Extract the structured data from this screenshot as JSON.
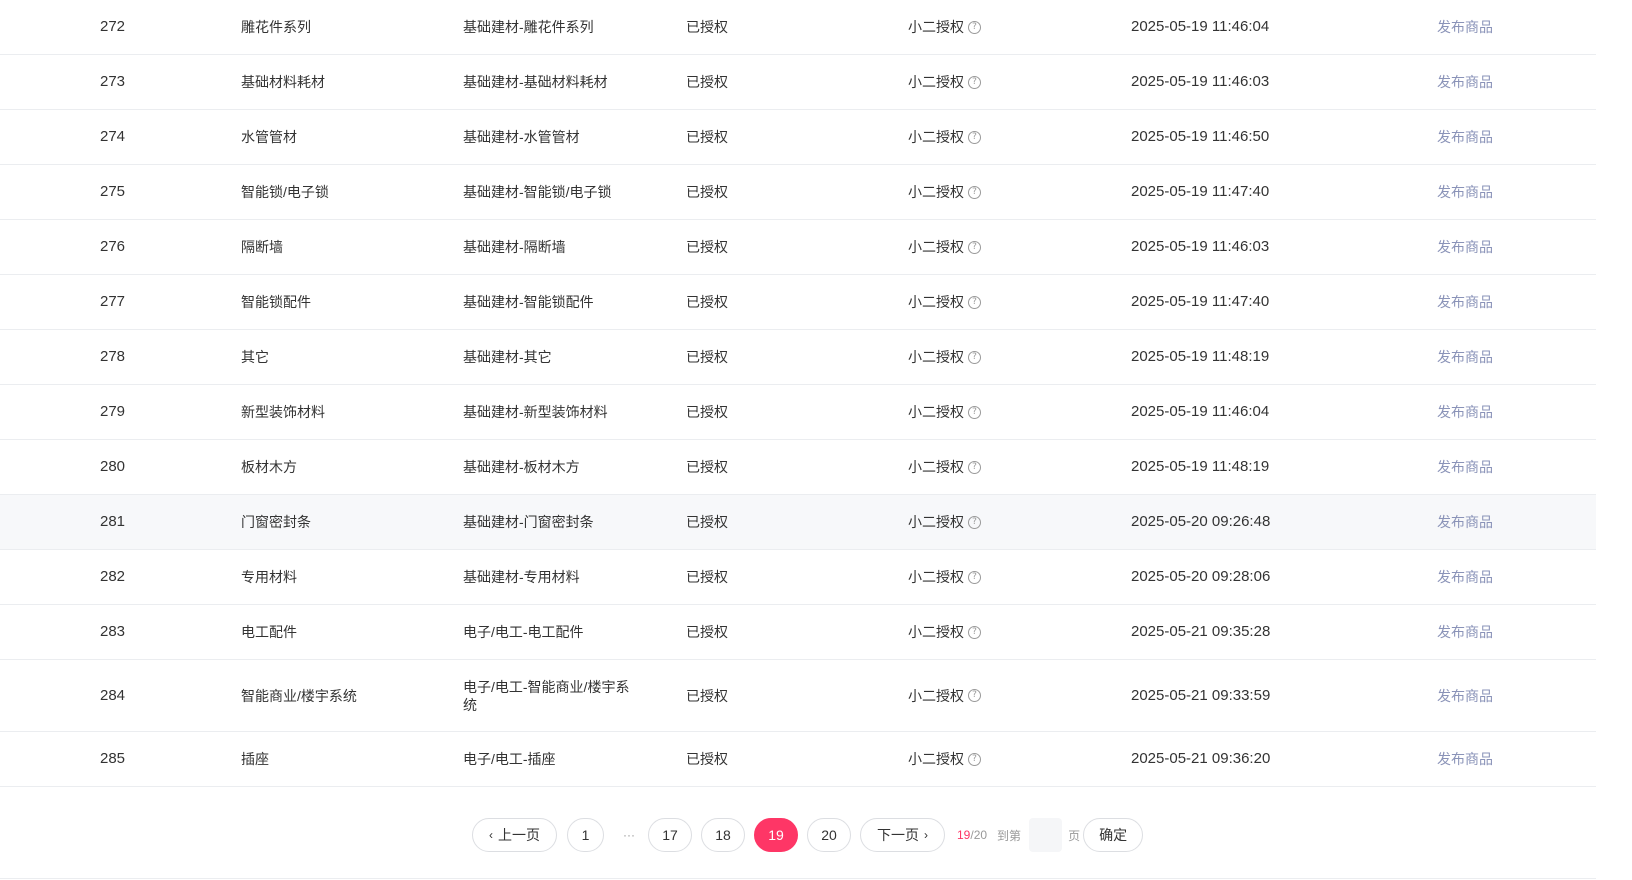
{
  "columns_help_icon": "question-circle-icon",
  "rows": [
    {
      "id": "272",
      "name": "雕花件系列",
      "path": "基础建材-雕花件系列",
      "status": "已授权",
      "auth": "小二授权",
      "time": "2025-05-19 11:46:04",
      "action": "发布商品"
    },
    {
      "id": "273",
      "name": "基础材料耗材",
      "path": "基础建材-基础材料耗材",
      "status": "已授权",
      "auth": "小二授权",
      "time": "2025-05-19 11:46:03",
      "action": "发布商品"
    },
    {
      "id": "274",
      "name": "水管管材",
      "path": "基础建材-水管管材",
      "status": "已授权",
      "auth": "小二授权",
      "time": "2025-05-19 11:46:50",
      "action": "发布商品"
    },
    {
      "id": "275",
      "name": "智能锁/电子锁",
      "path": "基础建材-智能锁/电子锁",
      "status": "已授权",
      "auth": "小二授权",
      "time": "2025-05-19 11:47:40",
      "action": "发布商品"
    },
    {
      "id": "276",
      "name": "隔断墙",
      "path": "基础建材-隔断墙",
      "status": "已授权",
      "auth": "小二授权",
      "time": "2025-05-19 11:46:03",
      "action": "发布商品"
    },
    {
      "id": "277",
      "name": "智能锁配件",
      "path": "基础建材-智能锁配件",
      "status": "已授权",
      "auth": "小二授权",
      "time": "2025-05-19 11:47:40",
      "action": "发布商品"
    },
    {
      "id": "278",
      "name": "其它",
      "path": "基础建材-其它",
      "status": "已授权",
      "auth": "小二授权",
      "time": "2025-05-19 11:48:19",
      "action": "发布商品"
    },
    {
      "id": "279",
      "name": "新型装饰材料",
      "path": "基础建材-新型装饰材料",
      "status": "已授权",
      "auth": "小二授权",
      "time": "2025-05-19 11:46:04",
      "action": "发布商品"
    },
    {
      "id": "280",
      "name": "板材木方",
      "path": "基础建材-板材木方",
      "status": "已授权",
      "auth": "小二授权",
      "time": "2025-05-19 11:48:19",
      "action": "发布商品"
    },
    {
      "id": "281",
      "name": "门窗密封条",
      "path": "基础建材-门窗密封条",
      "status": "已授权",
      "auth": "小二授权",
      "time": "2025-05-20 09:26:48",
      "action": "发布商品"
    },
    {
      "id": "282",
      "name": "专用材料",
      "path": "基础建材-专用材料",
      "status": "已授权",
      "auth": "小二授权",
      "time": "2025-05-20 09:28:06",
      "action": "发布商品"
    },
    {
      "id": "283",
      "name": "电工配件",
      "path": "电子/电工-电工配件",
      "status": "已授权",
      "auth": "小二授权",
      "time": "2025-05-21 09:35:28",
      "action": "发布商品"
    },
    {
      "id": "284",
      "name": "智能商业/楼宇系统",
      "path": "电子/电工-智能商业/楼宇系统",
      "status": "已授权",
      "auth": "小二授权",
      "time": "2025-05-21 09:33:59",
      "action": "发布商品"
    },
    {
      "id": "285",
      "name": "插座",
      "path": "电子/电工-插座",
      "status": "已授权",
      "auth": "小二授权",
      "time": "2025-05-21 09:36:20",
      "action": "发布商品"
    }
  ],
  "pagination": {
    "prev_label": "上一页",
    "next_label": "下一页",
    "pages": [
      "1",
      "17",
      "18",
      "19",
      "20"
    ],
    "ellipsis": "···",
    "current": "19",
    "total_sep": "/20",
    "goto_label": "到第",
    "page_unit": "页",
    "confirm_label": "确定",
    "active_color": "#fe3666"
  }
}
